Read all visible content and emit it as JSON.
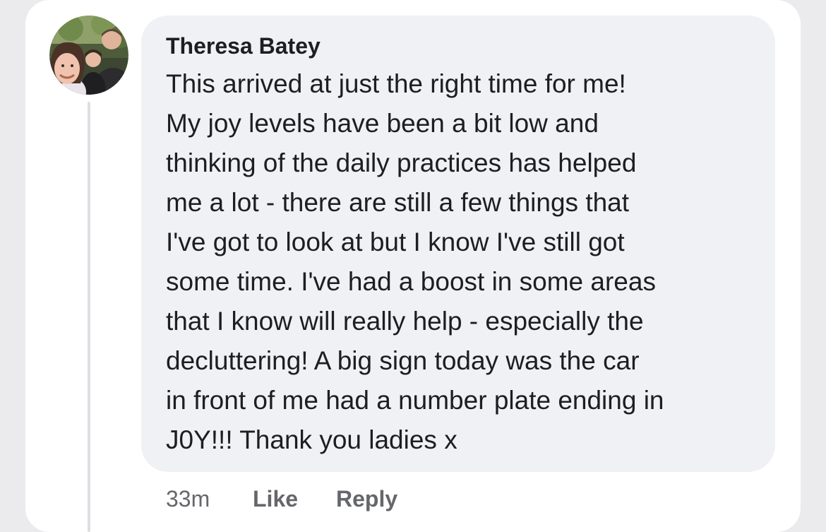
{
  "comment": {
    "author": "Theresa Batey",
    "avatar_icon": "profile-photo-avatar",
    "lines": [
      "This arrived at just the right time for me!",
      "My joy levels have been a bit low and",
      "thinking of the daily practices has helped",
      "me a lot - there are still a few things that",
      "I've got to look at but I know I've still got",
      "some time. I've had a boost in some areas",
      "that I know will really help - especially the",
      "decluttering! A big sign today was the car",
      "in front of me had a number plate ending in",
      "J0Y!!! Thank you ladies x"
    ],
    "timestamp": "33m",
    "like_label": "Like",
    "reply_label": "Reply"
  },
  "colors": {
    "background": "#ebebed",
    "card": "#ffffff",
    "bubble": "#f0f1f4",
    "text": "#1c1e21",
    "meta_text": "#65676b",
    "thread_line": "#dedfe2"
  }
}
